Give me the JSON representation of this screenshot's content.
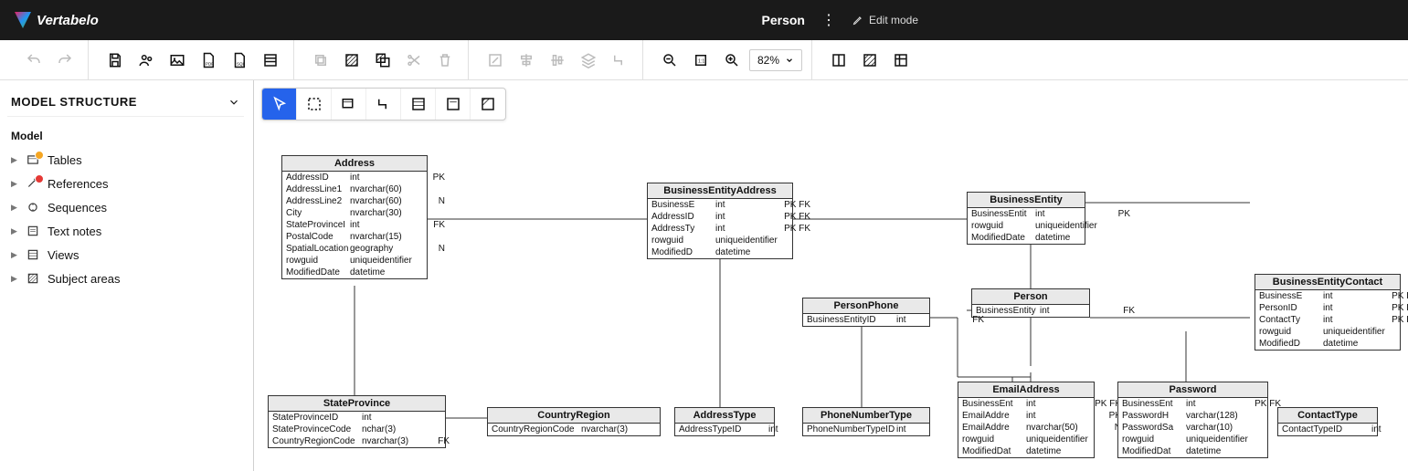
{
  "header": {
    "logo_text": "Vertabelo",
    "doc_title": "Person",
    "mode_label": "Edit mode"
  },
  "toolbar": {
    "zoom_value": "82%"
  },
  "sidebar": {
    "title": "MODEL STRUCTURE",
    "root_label": "Model",
    "items": [
      {
        "label": "Tables"
      },
      {
        "label": "References"
      },
      {
        "label": "Sequences"
      },
      {
        "label": "Text notes"
      },
      {
        "label": "Views"
      },
      {
        "label": "Subject areas"
      }
    ]
  },
  "entities": {
    "address": {
      "title": "Address",
      "rows": [
        {
          "name": "AddressID",
          "type": "int",
          "key": "PK"
        },
        {
          "name": "AddressLine1",
          "type": "nvarchar(60)",
          "key": ""
        },
        {
          "name": "AddressLine2",
          "type": "nvarchar(60)",
          "key": "N"
        },
        {
          "name": "City",
          "type": "nvarchar(30)",
          "key": ""
        },
        {
          "name": "StateProvinceI",
          "type": "int",
          "key": "FK"
        },
        {
          "name": "PostalCode",
          "type": "nvarchar(15)",
          "key": ""
        },
        {
          "name": "SpatialLocation",
          "type": "geography",
          "key": "N"
        },
        {
          "name": "rowguid",
          "type": "uniqueidentifier",
          "key": ""
        },
        {
          "name": "ModifiedDate",
          "type": "datetime",
          "key": ""
        }
      ]
    },
    "bea": {
      "title": "BusinessEntityAddress",
      "rows": [
        {
          "name": "BusinessE",
          "type": "int",
          "key": "PK FK"
        },
        {
          "name": "AddressID",
          "type": "int",
          "key": "PK FK"
        },
        {
          "name": "AddressTy",
          "type": "int",
          "key": "PK FK"
        },
        {
          "name": "rowguid",
          "type": "uniqueidentifier",
          "key": ""
        },
        {
          "name": "ModifiedD",
          "type": "datetime",
          "key": ""
        }
      ]
    },
    "be": {
      "title": "BusinessEntity",
      "rows": [
        {
          "name": "BusinessEntit",
          "type": "int",
          "key": "PK"
        },
        {
          "name": "rowguid",
          "type": "uniqueidentifier",
          "key": ""
        },
        {
          "name": "ModifiedDate",
          "type": "datetime",
          "key": ""
        }
      ]
    },
    "bec": {
      "title": "BusinessEntityContact",
      "rows": [
        {
          "name": "BusinessE",
          "type": "int",
          "key": "PK FK"
        },
        {
          "name": "PersonID",
          "type": "int",
          "key": "PK FK"
        },
        {
          "name": "ContactTy",
          "type": "int",
          "key": "PK FK"
        },
        {
          "name": "rowguid",
          "type": "uniqueidentifier",
          "key": ""
        },
        {
          "name": "ModifiedD",
          "type": "datetime",
          "key": ""
        }
      ]
    },
    "person": {
      "title": "Person",
      "rows": [
        {
          "name": "BusinessEntity",
          "type": "int",
          "key": "FK"
        }
      ]
    },
    "personphone": {
      "title": "PersonPhone",
      "rows": [
        {
          "name": "BusinessEntityID",
          "type": "int",
          "key": "FK"
        }
      ]
    },
    "stateprov": {
      "title": "StateProvince",
      "rows": [
        {
          "name": "StateProvinceID",
          "type": "int",
          "key": ""
        },
        {
          "name": "StateProvinceCode",
          "type": "nchar(3)",
          "key": ""
        },
        {
          "name": "CountryRegionCode",
          "type": "nvarchar(3)",
          "key": "FK"
        }
      ]
    },
    "countryregion": {
      "title": "CountryRegion",
      "rows": [
        {
          "name": "CountryRegionCode",
          "type": "nvarchar(3)",
          "key": ""
        }
      ]
    },
    "addresstype": {
      "title": "AddressType",
      "rows": [
        {
          "name": "AddressTypeID",
          "type": "int",
          "key": ""
        }
      ]
    },
    "phonenumtype": {
      "title": "PhoneNumberType",
      "rows": [
        {
          "name": "PhoneNumberTypeID",
          "type": "int",
          "key": ""
        }
      ]
    },
    "emailaddress": {
      "title": "EmailAddress",
      "rows": [
        {
          "name": "BusinessEnt",
          "type": "int",
          "key": "PK FK"
        },
        {
          "name": "EmailAddre",
          "type": "int",
          "key": "PK"
        },
        {
          "name": "EmailAddre",
          "type": "nvarchar(50)",
          "key": "N"
        },
        {
          "name": "rowguid",
          "type": "uniqueidentifier",
          "key": ""
        },
        {
          "name": "ModifiedDat",
          "type": "datetime",
          "key": ""
        }
      ]
    },
    "password": {
      "title": "Password",
      "rows": [
        {
          "name": "BusinessEnt",
          "type": "int",
          "key": "PK FK"
        },
        {
          "name": "PasswordH",
          "type": "varchar(128)",
          "key": ""
        },
        {
          "name": "PasswordSa",
          "type": "varchar(10)",
          "key": ""
        },
        {
          "name": "rowguid",
          "type": "uniqueidentifier",
          "key": ""
        },
        {
          "name": "ModifiedDat",
          "type": "datetime",
          "key": ""
        }
      ]
    },
    "contacttype": {
      "title": "ContactType",
      "rows": [
        {
          "name": "ContactTypeID",
          "type": "int",
          "key": ""
        }
      ]
    }
  }
}
